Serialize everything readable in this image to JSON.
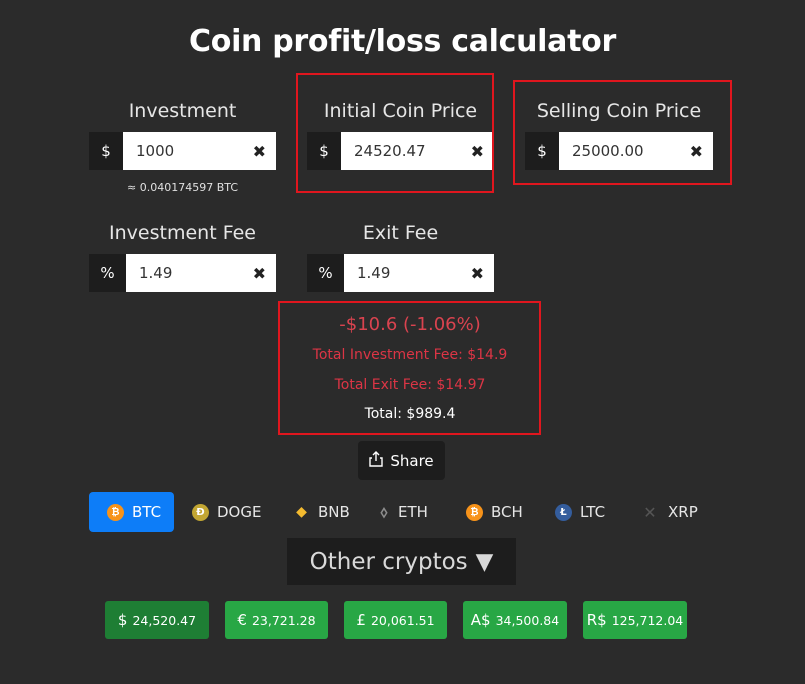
{
  "title": "Coin profit/loss calculator",
  "fields": {
    "investment": {
      "label": "Investment",
      "prefix": "$",
      "value": "1000",
      "clear": "✖",
      "hint": "≈ 0.040174597 BTC"
    },
    "initial_price": {
      "label": "Initial Coin Price",
      "prefix": "$",
      "value": "24520.47",
      "clear": "✖"
    },
    "selling_price": {
      "label": "Selling Coin Price",
      "prefix": "$",
      "value": "25000.00",
      "clear": "✖"
    },
    "investment_fee": {
      "label": "Investment Fee",
      "prefix": "%",
      "value": "1.49",
      "clear": "✖"
    },
    "exit_fee": {
      "label": "Exit Fee",
      "prefix": "%",
      "value": "1.49",
      "clear": "✖"
    }
  },
  "result": {
    "profit_loss": "-$10.6 (-1.06%)",
    "investment_fee": "Total Investment Fee: $14.9",
    "exit_fee": "Total Exit Fee: $14.97",
    "total": "Total: $989.4"
  },
  "share_label": "Share",
  "coins": [
    {
      "symbol": "BTC",
      "icon": "bitcoin-icon",
      "icon_glyph": "₿",
      "color": "#f7931a",
      "active": true
    },
    {
      "symbol": "DOGE",
      "icon": "dogecoin-icon",
      "icon_glyph": "Ð",
      "color": "#c2a633",
      "active": false
    },
    {
      "symbol": "BNB",
      "icon": "binance-icon",
      "icon_glyph": "◆",
      "color": "#f3ba2f",
      "active": false
    },
    {
      "symbol": "ETH",
      "icon": "ethereum-icon",
      "icon_glyph": "⬨",
      "color": "#8c8c8c",
      "active": false
    },
    {
      "symbol": "BCH",
      "icon": "bitcoin-cash-icon",
      "icon_glyph": "₿",
      "color": "#f7931a",
      "active": false
    },
    {
      "symbol": "LTC",
      "icon": "litecoin-icon",
      "icon_glyph": "Ł",
      "color": "#345d9d",
      "active": false
    },
    {
      "symbol": "XRP",
      "icon": "xrp-icon",
      "icon_glyph": "✕",
      "color": "#555555",
      "active": false
    }
  ],
  "other_cryptos": {
    "label": "Other cryptos",
    "arrow": "▼"
  },
  "prices": [
    {
      "symbol": "$",
      "value": "24,520.47",
      "active": true
    },
    {
      "symbol": "€",
      "value": "23,721.28",
      "active": false
    },
    {
      "symbol": "£",
      "value": "20,061.51",
      "active": false
    },
    {
      "symbol": "A$",
      "value": "34,500.84",
      "active": false
    },
    {
      "symbol": "R$",
      "value": "125,712.04",
      "active": false
    }
  ],
  "colors": {
    "accent": "#0d7df8",
    "loss": "#dc3545",
    "highlight": "#e0161e",
    "price_bg": "#28a745"
  }
}
